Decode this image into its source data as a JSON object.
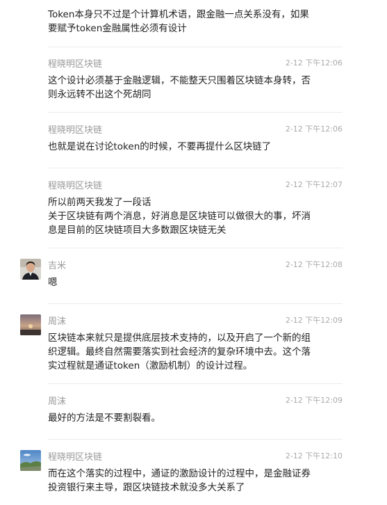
{
  "messages": [
    {
      "text": "Token本身只不过是个计算机术语，跟金融一点关系没有，如果\n要赋予token金融属性必须有设计"
    },
    {
      "author": "程晓明区块链",
      "time": "2-12 下午12:06",
      "text": "这个设计必须基于金融逻辑，不能整天只围着区块链本身转，否\n则永远转不出这个死胡同"
    },
    {
      "author": "程晓明区块链",
      "time": "2-12 下午12:06",
      "text": "也就是说在讨论token的时候，不要再提什么区块链了"
    },
    {
      "author": "程晓明区块链",
      "time": "2-12 下午12:07",
      "text": "所以前两天我发了一段话\n关于区块链有两个消息，好消息是区块链可以做很大的事，坏消\n息是目前的区块链项目大多数跟区块链无关"
    },
    {
      "author": "吉米",
      "time": "2-12 下午12:08",
      "text": "嗯",
      "avatar_icon": "user-photo-icon"
    },
    {
      "author": "周沫",
      "time": "2-12 下午12:09",
      "text": "区块链本来就只是提供底层技术支持的，以及开启了一个新的组\n织逻辑。最终自然需要落实到社会经济的复杂环境中去。这个落\n实过程就是通证token（激励机制）的设计过程。",
      "avatar_icon": "sunset-photo-icon"
    },
    {
      "author": "周沫",
      "time": "2-12 下午12:09",
      "text": "最好的方法是不要割裂看。"
    },
    {
      "author": "程晓明区块链",
      "time": "2-12 下午12:10",
      "text": "而在这个落实的过程中，通证的激励设计的过程中，是金融证券\n投资银行来主导，跟区块链技术就没多大关系了",
      "avatar_icon": "landscape-photo-icon"
    }
  ],
  "colors": {
    "name": "#999999",
    "time": "#aaaaaa",
    "text": "#222222",
    "divider": "#ececec"
  }
}
